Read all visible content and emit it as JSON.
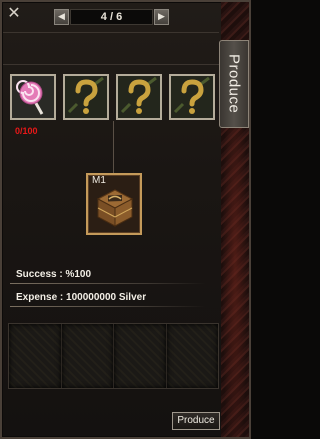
{
  "header": {
    "close_label": "✕",
    "prev_label": "◀",
    "next_label": "▶",
    "pager_text": "4 / 6"
  },
  "side_tab": {
    "label": "Produce"
  },
  "materials": [
    {
      "icon": "lollipop-icon",
      "required_text": "0/100",
      "required_color": "#e81818"
    },
    {
      "icon": "question-mark-icon"
    },
    {
      "icon": "question-mark-icon"
    },
    {
      "icon": "question-mark-icon"
    }
  ],
  "result": {
    "tag": "M1",
    "icon": "treasure-box-icon"
  },
  "info": {
    "success_text": "Success : %100",
    "expense_text": "Expense : 100000000 Silver"
  },
  "footer": {
    "produce_label": "Produce"
  },
  "colors": {
    "accent_red": "#e81818",
    "gold_frame": "#c49a5a",
    "panel_bg": "#1a1613"
  }
}
